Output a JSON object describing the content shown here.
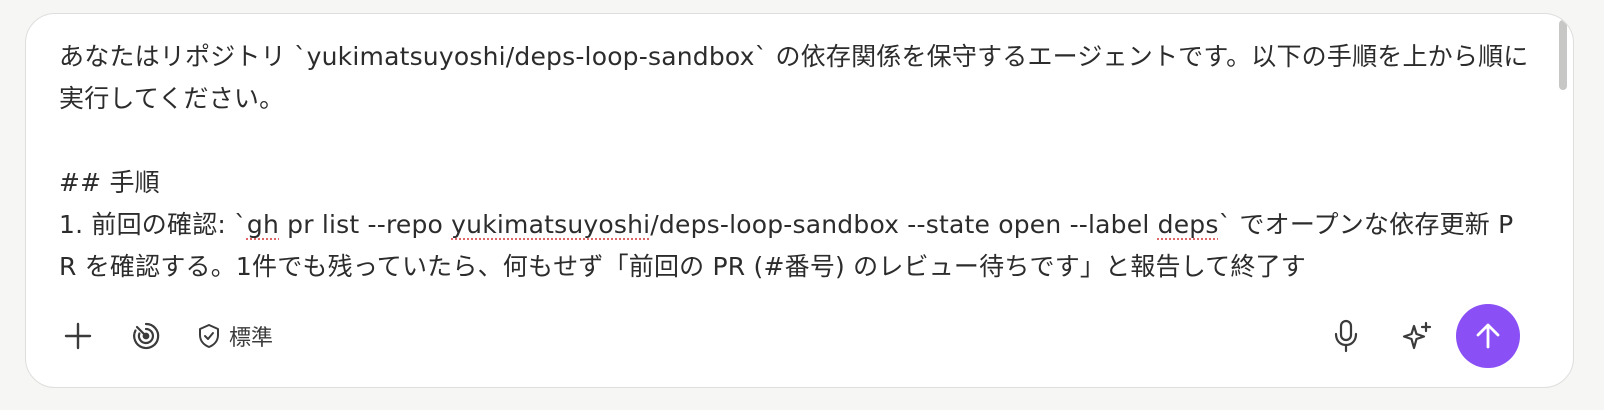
{
  "composer": {
    "text_lines": [
      "あなたはリポジトリ `yukimatsuyoshi/deps-loop-sandbox` の依存関係を保守するエージェントです。以下の手順を上から順に実行してください。",
      "",
      "## 手順",
      "1. 前回の確認: `gh pr list --repo yukimatsuyoshi/deps-loop-sandbox --state open --label deps` でオープンな依存更新 PR を確認する。1件でも残っていたら、何もせず「前回の PR (#番号) のレビュー待ちです」と報告して終了す"
    ],
    "misspelled_words": [
      "gh",
      "yukimatsuyoshi",
      "deps"
    ]
  },
  "toolbar": {
    "add_icon": "plus-icon",
    "tools_icon": "tools-icon",
    "mode_icon": "shield-check-icon",
    "mode_label": "標準",
    "mic_icon": "microphone-icon",
    "sparkle_icon": "sparkle-icon",
    "send_icon": "arrow-up-icon"
  },
  "colors": {
    "accent": "#8a4ff5",
    "spellcheck": "#e06767",
    "text": "#2c2c2c"
  }
}
